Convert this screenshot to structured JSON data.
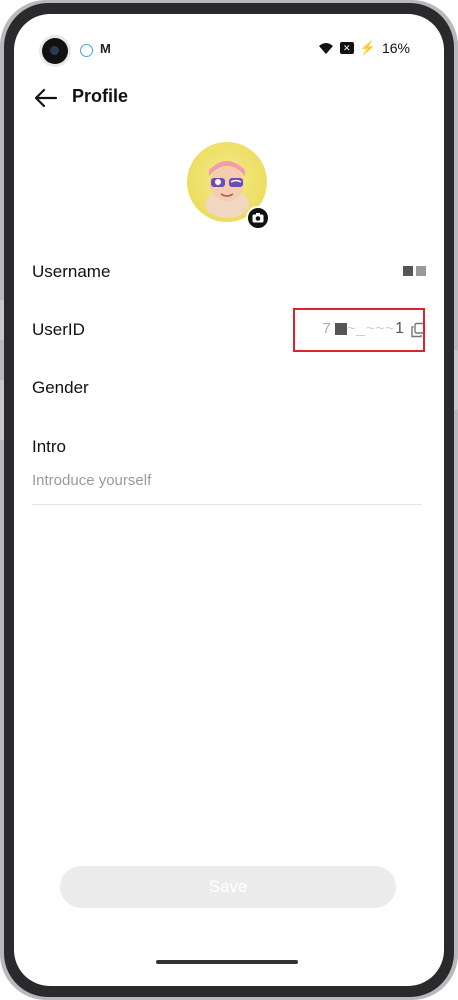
{
  "status_bar": {
    "battery": "16%"
  },
  "header": {
    "title": "Profile"
  },
  "profile": {
    "username": {
      "label": "Username",
      "value": ""
    },
    "userid": {
      "label": "UserID",
      "value_fragment": "1"
    },
    "gender": {
      "label": "Gender"
    },
    "intro": {
      "label": "Intro",
      "placeholder": "Introduce yourself"
    }
  },
  "actions": {
    "save_label": "Save"
  },
  "colors": {
    "highlight": "#d9232e",
    "save_disabled": "#ececec"
  }
}
